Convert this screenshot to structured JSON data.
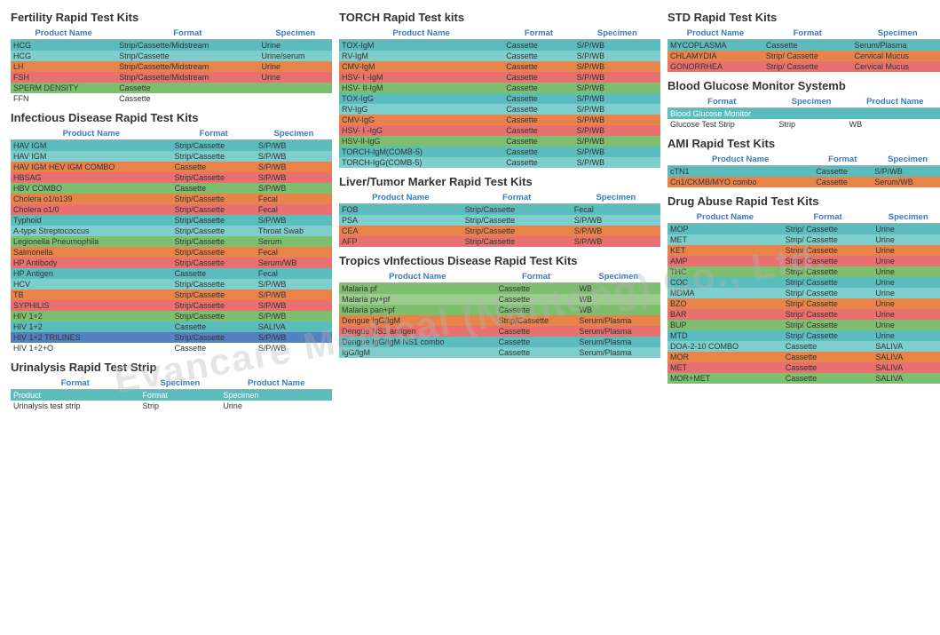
{
  "watermark": "Evancare Medical (Nantong) Co., Ltd.",
  "sections": {
    "fertility": {
      "title": "Fertility Rapid Test Kits",
      "headers": [
        "Product Name",
        "Format",
        "Specimen"
      ],
      "rows": [
        {
          "name": "HCG",
          "format": "Strip/Cassette/Midstream",
          "specimen": "Urine",
          "style": "teal"
        },
        {
          "name": "HCG",
          "format": "Strip/Cassette",
          "specimen": "Urine/serum",
          "style": "teal2"
        },
        {
          "name": "LH",
          "format": "Strip/Cassette/Midstream",
          "specimen": "Urine",
          "style": "orange"
        },
        {
          "name": "FSH",
          "format": "Strip/Cassette/Midstream",
          "specimen": "Urine",
          "style": "pink"
        },
        {
          "name": "SPERM DENSITY",
          "format": "Cassette",
          "specimen": "",
          "style": "green"
        },
        {
          "name": "FFN",
          "format": "Cassette",
          "specimen": "",
          "style": "plain"
        }
      ]
    },
    "infectious": {
      "title": "Infectious Disease Rapid Test Kits",
      "headers": [
        "Product Name",
        "Format",
        "Specimen"
      ],
      "rows": [
        {
          "name": "HAV IGM",
          "format": "Strip/Cassette",
          "specimen": "S/P/WB",
          "style": "teal"
        },
        {
          "name": "HAV IGM",
          "format": "Strip/Cassette",
          "specimen": "S/P/WB",
          "style": "teal2"
        },
        {
          "name": "HAV IGM HEV IGM COMBO",
          "format": "Cassette",
          "specimen": "S/P/WB",
          "style": "orange"
        },
        {
          "name": "HBSAG",
          "format": "Strip/Cassette",
          "specimen": "S/P/WB",
          "style": "pink"
        },
        {
          "name": "HBV COMBO",
          "format": "Cassette",
          "specimen": "S/P/WB",
          "style": "green"
        },
        {
          "name": "Cholera o1/o139",
          "format": "Strip/Cassette",
          "specimen": "Fecal",
          "style": "orange"
        },
        {
          "name": "Cholera o1/0",
          "format": "Strip/Cassette",
          "specimen": "Fecal",
          "style": "pink"
        },
        {
          "name": "Typhoid",
          "format": "Strip/Cassette",
          "specimen": "S/P/WB",
          "style": "teal"
        },
        {
          "name": "A-type Streptococcus",
          "format": "Strip/Cassette",
          "specimen": "Throat Swab",
          "style": "teal2"
        },
        {
          "name": "Legionella Pneumophila",
          "format": "Strip/Cassette",
          "specimen": "Serum",
          "style": "green"
        },
        {
          "name": "Salmonella",
          "format": "Strip/Cassette",
          "specimen": "Fecal",
          "style": "orange"
        },
        {
          "name": "HP Antibody",
          "format": "Strip/Cassette",
          "specimen": "Serum/WB",
          "style": "pink"
        },
        {
          "name": "HP Antigen",
          "format": "Cassette",
          "specimen": "Fecal",
          "style": "teal"
        },
        {
          "name": "HCV",
          "format": "Strip/Cassette",
          "specimen": "S/P/WB",
          "style": "teal2"
        },
        {
          "name": "TB",
          "format": "Strip/Cassette",
          "specimen": "S/P/WB",
          "style": "orange"
        },
        {
          "name": "SYPHILIS",
          "format": "Strip/Cassette",
          "specimen": "S/P/WB",
          "style": "pink"
        },
        {
          "name": "HIV 1+2",
          "format": "Strip/Cassette",
          "specimen": "S/P/WB",
          "style": "green"
        },
        {
          "name": "HIV 1+2",
          "format": "Cassette",
          "specimen": "SALIVA",
          "style": "teal"
        },
        {
          "name": "HIV 1+2 TRILINES",
          "format": "Strip/Cassette",
          "specimen": "S/P/WB",
          "style": "blue"
        },
        {
          "name": "HIV 1+2+O",
          "format": "Cassette",
          "specimen": "S/P/WB",
          "style": "plain"
        }
      ]
    },
    "urinalysis": {
      "title": "Urinalysis Rapid Test Strip",
      "headers": [
        "Format",
        "Specimen",
        "Product Name"
      ],
      "rows": [
        {
          "col1": "Product",
          "col2": "Format",
          "col3": "Specimen",
          "style": "teal"
        },
        {
          "col1": "Urinalysis test strip",
          "col2": "Strip",
          "col3": "Urine",
          "style": "plain"
        }
      ]
    },
    "torch": {
      "title": "TORCH Rapid Test kits",
      "headers": [
        "Product Name",
        "Format",
        "Specimen"
      ],
      "rows": [
        {
          "name": "TOX-IgM",
          "format": "Cassette",
          "specimen": "S/P/WB",
          "style": "teal"
        },
        {
          "name": "RV-IgM",
          "format": "Cassette",
          "specimen": "S/P/WB",
          "style": "teal2"
        },
        {
          "name": "CMV-IgM",
          "format": "Cassette",
          "specimen": "S/P/WB",
          "style": "orange"
        },
        {
          "name": "HSV- I -IgM",
          "format": "Cassette",
          "specimen": "S/P/WB",
          "style": "pink"
        },
        {
          "name": "HSV- II-IgM",
          "format": "Cassette",
          "specimen": "S/P/WB",
          "style": "green"
        },
        {
          "name": "TOX-IgG",
          "format": "Cassette",
          "specimen": "S/P/WB",
          "style": "teal"
        },
        {
          "name": "RV-IgG",
          "format": "Cassette",
          "specimen": "S/P/WB",
          "style": "teal2"
        },
        {
          "name": "CMV-IgG",
          "format": "Cassette",
          "specimen": "S/P/WB",
          "style": "orange"
        },
        {
          "name": "HSV- I -IgG",
          "format": "Cassette",
          "specimen": "S/P/WB",
          "style": "pink"
        },
        {
          "name": "HSV-II-IgG",
          "format": "Cassette",
          "specimen": "S/P/WB",
          "style": "green"
        },
        {
          "name": "TORCH-IgM(COMB-5)",
          "format": "Cassette",
          "specimen": "S/P/WB",
          "style": "teal"
        },
        {
          "name": "TORCH-IgG(COMB-5)",
          "format": "Cassette",
          "specimen": "S/P/WB",
          "style": "teal2"
        }
      ]
    },
    "tumor": {
      "title": "Liver/Tumor Marker Rapid Test Kits",
      "headers": [
        "Product Name",
        "Format",
        "Specimen"
      ],
      "rows": [
        {
          "name": "FOB",
          "format": "Strip/Cassette",
          "specimen": "Fecal",
          "style": "teal"
        },
        {
          "name": "PSA",
          "format": "Strip/Cassette",
          "specimen": "S/P/WB",
          "style": "teal2"
        },
        {
          "name": "CEA",
          "format": "Strip/Cassette",
          "specimen": "S/P/WB",
          "style": "orange"
        },
        {
          "name": "AFP",
          "format": "Strip/Cassette",
          "specimen": "S/P/WB",
          "style": "pink"
        }
      ]
    },
    "tropics": {
      "title": "Tropics vInfectious Disease Rapid Test Kits",
      "headers": [
        "Product Name",
        "Format",
        "Specimen"
      ],
      "rows": [
        {
          "name": "Malaria pf",
          "format": "Cassette",
          "specimen": "WB",
          "style": "green"
        },
        {
          "name": "Malaria pv+pf",
          "format": "Cassette",
          "specimen": "WB",
          "style": "green2"
        },
        {
          "name": "Malaria pan+pf",
          "format": "Cassette",
          "specimen": "WB",
          "style": "green"
        },
        {
          "name": "Dengue IgG/IgM",
          "format": "Strip/Cassette",
          "specimen": "Serum/Plasma",
          "style": "orange"
        },
        {
          "name": "Dengue NS1 antigen",
          "format": "Cassette",
          "specimen": "Serum/Plasma",
          "style": "pink"
        },
        {
          "name": "Dengue IgG/IgM NS1 combo",
          "format": "Cassette",
          "specimen": "Serum/Plasma",
          "style": "teal"
        },
        {
          "name": "IgG/IgM",
          "format": "Cassette",
          "specimen": "Serum/Plasma",
          "style": "teal2"
        }
      ]
    },
    "std": {
      "title": "STD Rapid Test Kits",
      "headers": [
        "Product Name",
        "Format",
        "Specimen"
      ],
      "rows": [
        {
          "name": "MYCOPLASMA",
          "format": "Cassette",
          "specimen": "Serum/Plasma",
          "style": "teal"
        },
        {
          "name": "CHLAMYDIA",
          "format": "Strip/ Cassette",
          "specimen": "Cervical Mucus",
          "style": "orange"
        },
        {
          "name": "GONORRHEA",
          "format": "Strip/ Cassette",
          "specimen": "Cervical Mucus",
          "style": "pink"
        }
      ]
    },
    "bloodglucose": {
      "title": "Blood Glucose Monitor Systemb",
      "headers": [
        "Format",
        "Specimen",
        "Product Name"
      ],
      "rows": [
        {
          "col1": "Blood Glucose Monitor",
          "col2": "",
          "col3": "",
          "style": "teal"
        },
        {
          "col1": "Glucose Test Strip",
          "col2": "Strip",
          "col3": "WB",
          "style": "plain"
        }
      ]
    },
    "ami": {
      "title": "AMI  Rapid Test Kits",
      "headers": [
        "Product Name",
        "Format",
        "Specimen"
      ],
      "rows": [
        {
          "name": "cTN1",
          "format": "Cassette",
          "specimen": "S/P/WB",
          "style": "teal"
        },
        {
          "name": "Cn1/CKMB/MYO combo",
          "format": "Cassette",
          "specimen": "Serum/WB",
          "style": "orange"
        }
      ]
    },
    "drugabuse": {
      "title": "Drug Abuse Rapid Test Kits",
      "headers": [
        "Product Name",
        "Format",
        "Specimen"
      ],
      "rows": [
        {
          "name": "MOP",
          "format": "Strip/ Cassette",
          "specimen": "Urine",
          "style": "teal"
        },
        {
          "name": "MET",
          "format": "Strip/ Cassette",
          "specimen": "Urine",
          "style": "teal2"
        },
        {
          "name": "KET",
          "format": "Strip/ Cassette",
          "specimen": "Urine",
          "style": "orange"
        },
        {
          "name": "AMP",
          "format": "Strip/ Cassette",
          "specimen": "Urine",
          "style": "pink"
        },
        {
          "name": "THC",
          "format": "Strip/ Cassette",
          "specimen": "Urine",
          "style": "green"
        },
        {
          "name": "COC",
          "format": "Strip/ Cassette",
          "specimen": "Urine",
          "style": "teal"
        },
        {
          "name": "MDMA",
          "format": "Strip/ Cassette",
          "specimen": "Urine",
          "style": "teal2"
        },
        {
          "name": "BZO",
          "format": "Strip/ Cassette",
          "specimen": "Urine",
          "style": "orange"
        },
        {
          "name": "BAR",
          "format": "Strip/ Cassette",
          "specimen": "Urine",
          "style": "pink"
        },
        {
          "name": "BUP",
          "format": "Strip/ Cassette",
          "specimen": "Urine",
          "style": "green"
        },
        {
          "name": "MTD",
          "format": "Strip/ Cassette",
          "specimen": "Urine",
          "style": "teal"
        },
        {
          "name": "DOA-2-10 COMBO",
          "format": "Cassette",
          "specimen": "SALIVA",
          "style": "teal2"
        },
        {
          "name": "MOR",
          "format": "Cassette",
          "specimen": "SALIVA",
          "style": "orange"
        },
        {
          "name": "MET",
          "format": "Cassette",
          "specimen": "SALIVA",
          "style": "pink"
        },
        {
          "name": "MOR+MET",
          "format": "Cassette",
          "specimen": "SALIVA",
          "style": "green"
        }
      ]
    }
  }
}
